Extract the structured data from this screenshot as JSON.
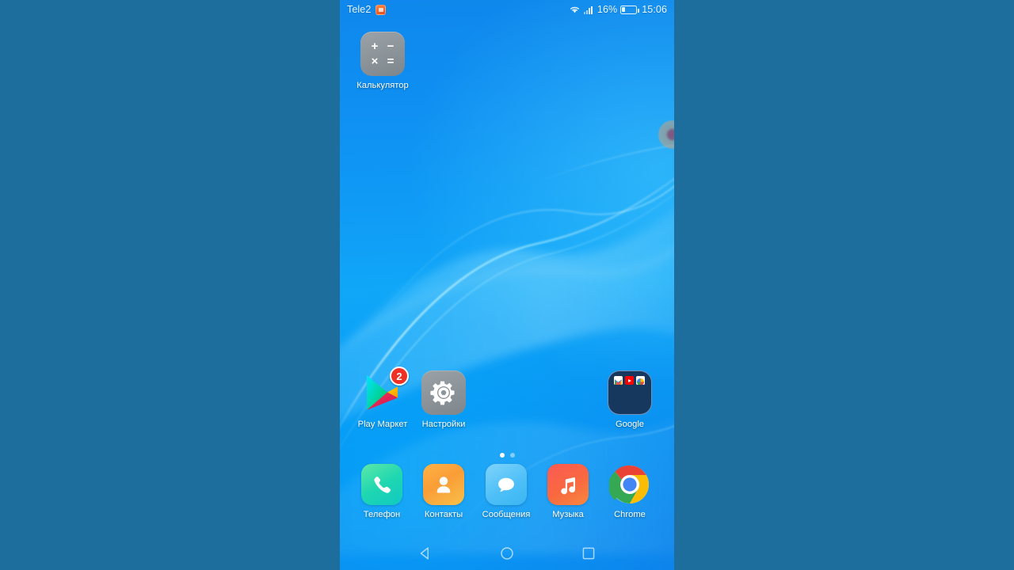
{
  "status_bar": {
    "carrier": "Tele2",
    "notification_icon": "app-notification-icon",
    "wifi_icon": "wifi-icon",
    "signal_icon": "cellular-signal-icon",
    "battery_percent": "16%",
    "battery_icon": "battery-icon",
    "clock": "15:06"
  },
  "home_screen": {
    "apps": [
      {
        "name": "calculator",
        "label": "Калькулятор",
        "icon": "calculator-icon",
        "symbols": [
          "+",
          "−",
          "×",
          "="
        ]
      },
      {
        "name": "play-market",
        "label": "Play Маркет",
        "icon": "play-store-icon",
        "badge": "2"
      },
      {
        "name": "settings",
        "label": "Настройки",
        "icon": "gear-icon"
      },
      {
        "name": "google-folder",
        "label": "Google",
        "icon": "folder-icon",
        "mini_icons": [
          "gmail-icon",
          "youtube-icon",
          "photos-icon"
        ]
      }
    ],
    "page_indicator": {
      "total": 2,
      "active": 1
    }
  },
  "dock": {
    "apps": [
      {
        "name": "phone",
        "label": "Телефон",
        "icon": "phone-handset-icon",
        "color": "#1fd7b0"
      },
      {
        "name": "contacts",
        "label": "Контакты",
        "icon": "person-icon",
        "color": "#fa9d36"
      },
      {
        "name": "messages",
        "label": "Сообщения",
        "icon": "speech-bubble-icon",
        "color": "#4fc0f7"
      },
      {
        "name": "music",
        "label": "Музыка",
        "icon": "music-note-icon",
        "color": "#f9693f"
      },
      {
        "name": "chrome",
        "label": "Chrome",
        "icon": "chrome-icon",
        "color": "#4285f4"
      }
    ]
  },
  "nav_bar": {
    "back": "back-triangle-icon",
    "home": "home-circle-icon",
    "recents": "recents-square-icon"
  },
  "pointer": {
    "name": "touch-indicator",
    "color": "#aa3246"
  },
  "theme": {
    "letterbox": "#1d6e9d",
    "wallpaper_blue": "#0f9bf6",
    "badge_red": "#ee3124",
    "folder_navy": "#17385e"
  }
}
